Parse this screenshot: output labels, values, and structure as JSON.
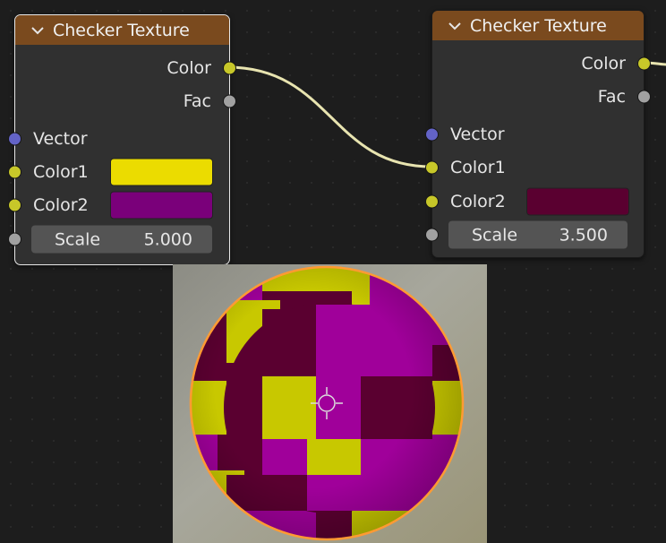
{
  "nodes": [
    {
      "title": "Checker Texture",
      "outputs": [
        {
          "label": "Color"
        },
        {
          "label": "Fac"
        }
      ],
      "inputs": {
        "vector": "Vector",
        "color1": "Color1",
        "color2": "Color2",
        "scale_label": "Scale",
        "scale_value": "5.000"
      },
      "color1_swatch": "#ebdc00",
      "color2_swatch": "#7a007a"
    },
    {
      "title": "Checker Texture",
      "outputs": [
        {
          "label": "Color"
        },
        {
          "label": "Fac"
        }
      ],
      "inputs": {
        "vector": "Vector",
        "color1": "Color1",
        "color2": "Color2",
        "scale_label": "Scale",
        "scale_value": "3.500"
      },
      "color2_swatch": "#5a0030"
    }
  ],
  "colors": {
    "header": "#7a4a1e",
    "node_body": "#303030",
    "socket_color": "#c7c729",
    "socket_float": "#a1a1a1",
    "socket_vector": "#6363c7",
    "wire": "#e8e4b0",
    "sphere_magenta": "#a0009a",
    "sphere_yellow": "#c8c800",
    "sphere_dark": "#5a0030",
    "selection_outline": "#ff9a33"
  },
  "viewport": {
    "content": "sphere-preview"
  }
}
